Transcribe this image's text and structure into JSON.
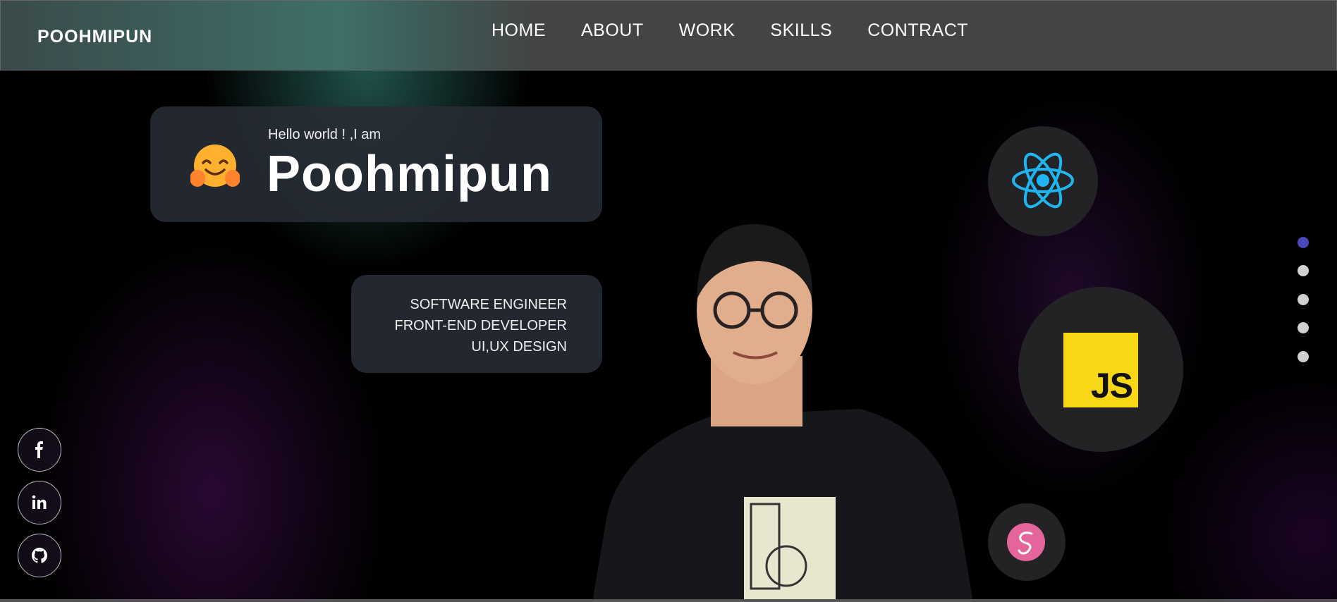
{
  "header": {
    "logo": "POOHMIPUN",
    "nav": [
      "HOME",
      "ABOUT",
      "WORK",
      "SKILLS",
      "CONTRACT"
    ]
  },
  "hero": {
    "greeting": "Hello world ! ,I am",
    "name": "Poohmipun",
    "emoji": "hugging-face-emoji",
    "roles": [
      "SOFTWARE ENGINEER",
      "FRONT-END DEVELOPER",
      "UI,UX DESIGN"
    ]
  },
  "skills": {
    "icons": [
      "react-icon",
      "javascript-icon",
      "sass-icon"
    ],
    "js_label": "JS"
  },
  "pagination": {
    "count": 5,
    "active_index": 0,
    "active_color": "#4a47b8",
    "inactive_color": "#cfcfcf"
  },
  "social": [
    "facebook-icon",
    "linkedin-icon",
    "github-icon"
  ],
  "colors": {
    "js_yellow": "#f7d716",
    "react_cyan": "#1fb6f0",
    "sass_pink": "#e4649c"
  }
}
